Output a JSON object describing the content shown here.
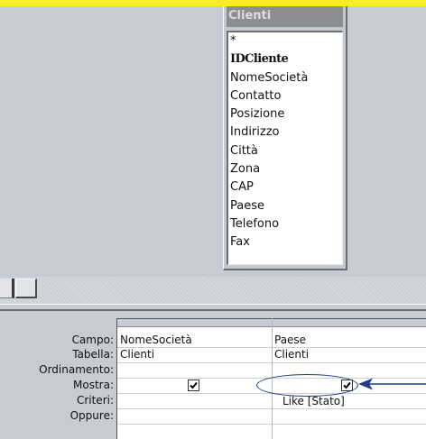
{
  "table_window": {
    "title": "Clienti",
    "fields": [
      "*",
      "IDCliente",
      "NomeSocietà",
      "Contatto",
      "Posizione",
      "Indirizzo",
      "Città",
      "Zona",
      "CAP",
      "Paese",
      "Telefono",
      "Fax"
    ],
    "primary_key_field": "IDCliente"
  },
  "grid": {
    "row_labels": {
      "campo": "Campo:",
      "tabella": "Tabella:",
      "ordinamento": "Ordinamento:",
      "mostra": "Mostra:",
      "criteri": "Criteri:",
      "oppure": "Oppure:"
    },
    "columns": [
      {
        "campo": "NomeSocietà",
        "tabella": "Clienti",
        "ordinamento": "",
        "mostra": true,
        "criteri": "",
        "oppure": ""
      },
      {
        "campo": "Paese",
        "tabella": "Clienti",
        "ordinamento": "",
        "mostra": true,
        "criteri": "Like [Stato]",
        "oppure": ""
      }
    ]
  },
  "colors": {
    "title_highlight": "#f7ef1e",
    "annotation": "#1d3e84",
    "window_title_bar": "#8c8e92",
    "background": "#c7cbd3"
  }
}
